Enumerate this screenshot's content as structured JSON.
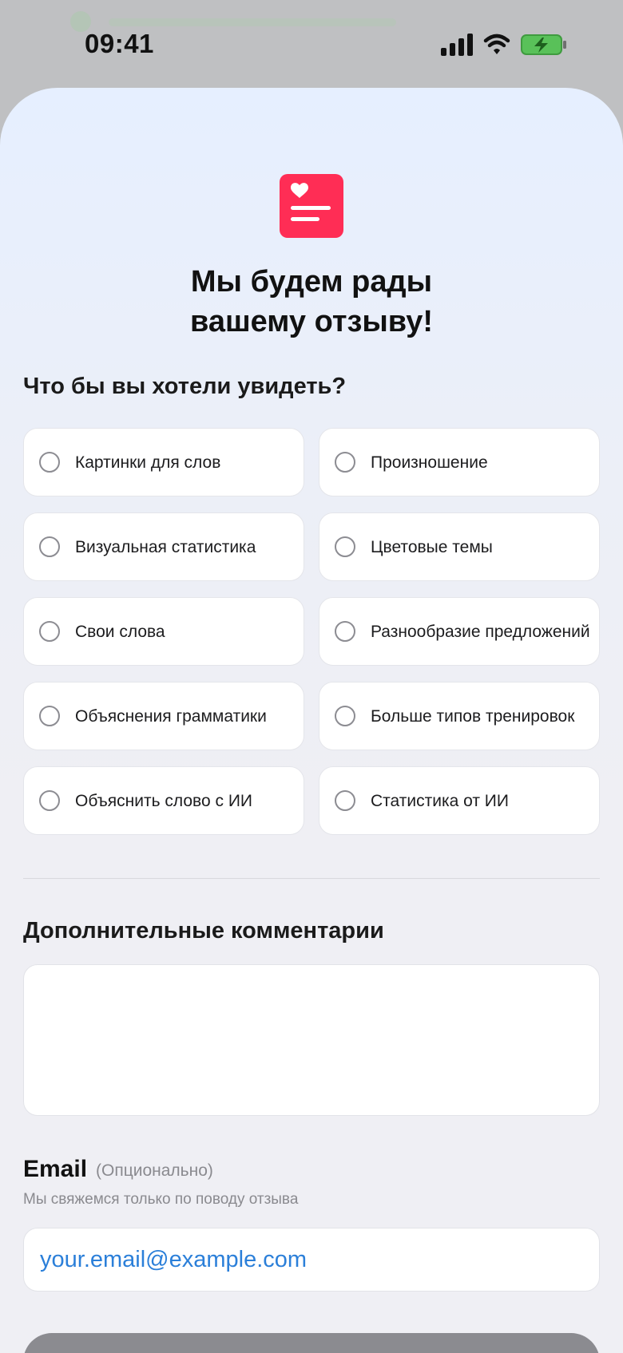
{
  "status_bar": {
    "time": "09:41"
  },
  "header": {
    "title_line1": "Мы будем рады",
    "title_line2": "вашему отзыву!",
    "icon": "heart-document-icon",
    "accent_color": "#ff2d55"
  },
  "features": {
    "title": "Что бы вы хотели увидеть?",
    "options": [
      {
        "label": "Картинки для слов",
        "selected": false
      },
      {
        "label": "Произношение",
        "selected": false
      },
      {
        "label": "Визуальная статистика",
        "selected": false
      },
      {
        "label": "Цветовые темы",
        "selected": false
      },
      {
        "label": "Свои слова",
        "selected": false
      },
      {
        "label": "Разнообразие предложений",
        "selected": false
      },
      {
        "label": "Объяснения грамматики",
        "selected": false
      },
      {
        "label": "Больше типов тренировок",
        "selected": false
      },
      {
        "label": "Объяснить слово с ИИ",
        "selected": false
      },
      {
        "label": "Статистика от ИИ",
        "selected": false
      }
    ]
  },
  "comments": {
    "title": "Дополнительные комментарии",
    "value": ""
  },
  "email": {
    "label": "Email",
    "optional": "(Опционально)",
    "hint": "Мы свяжемся только по поводу отзыва",
    "placeholder": "your.email@example.com",
    "value": ""
  }
}
